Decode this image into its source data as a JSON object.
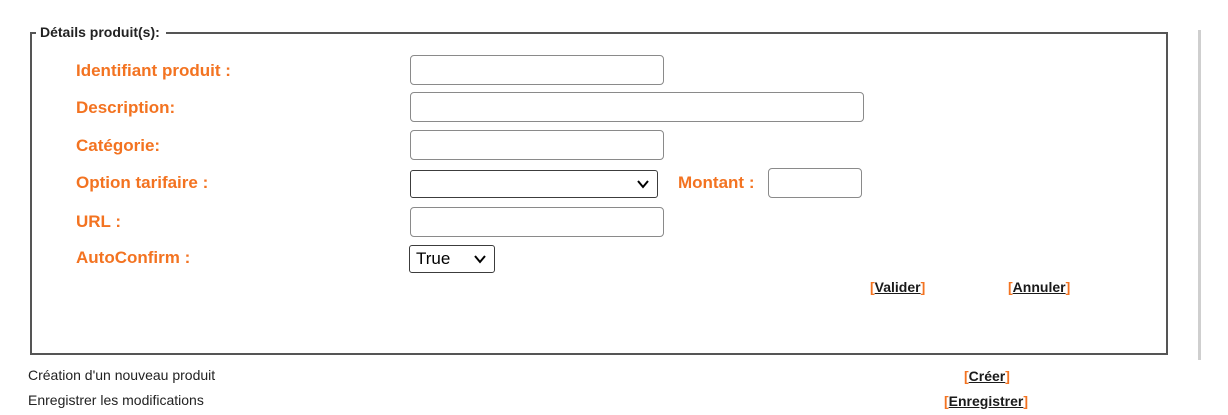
{
  "section": {
    "legend": "Détails produit(s):"
  },
  "form": {
    "product_id_label": "Identifiant produit :",
    "description_label": "Description:",
    "category_label": "Catégorie:",
    "pricing_option_label": "Option tarifaire :",
    "amount_label": "Montant :",
    "url_label": "URL :",
    "autoconfirm_label": "AutoConfirm :",
    "autoconfirm_value": "True",
    "pricing_option_value": "",
    "product_id_value": "",
    "description_value": "",
    "category_value": "",
    "amount_value": "",
    "url_value": ""
  },
  "actions": {
    "validate_label": "Valider",
    "cancel_label": "Annuler",
    "create_label": "Créer",
    "save_label": "Enregistrer"
  },
  "footer": {
    "create_text": "Création d'un nouveau produit",
    "save_text": "Enregistrer les modifications"
  },
  "colors": {
    "label_orange": "#f37321",
    "border_gray": "#555555"
  },
  "icons": {
    "dropdown": "chevron-down-icon"
  }
}
